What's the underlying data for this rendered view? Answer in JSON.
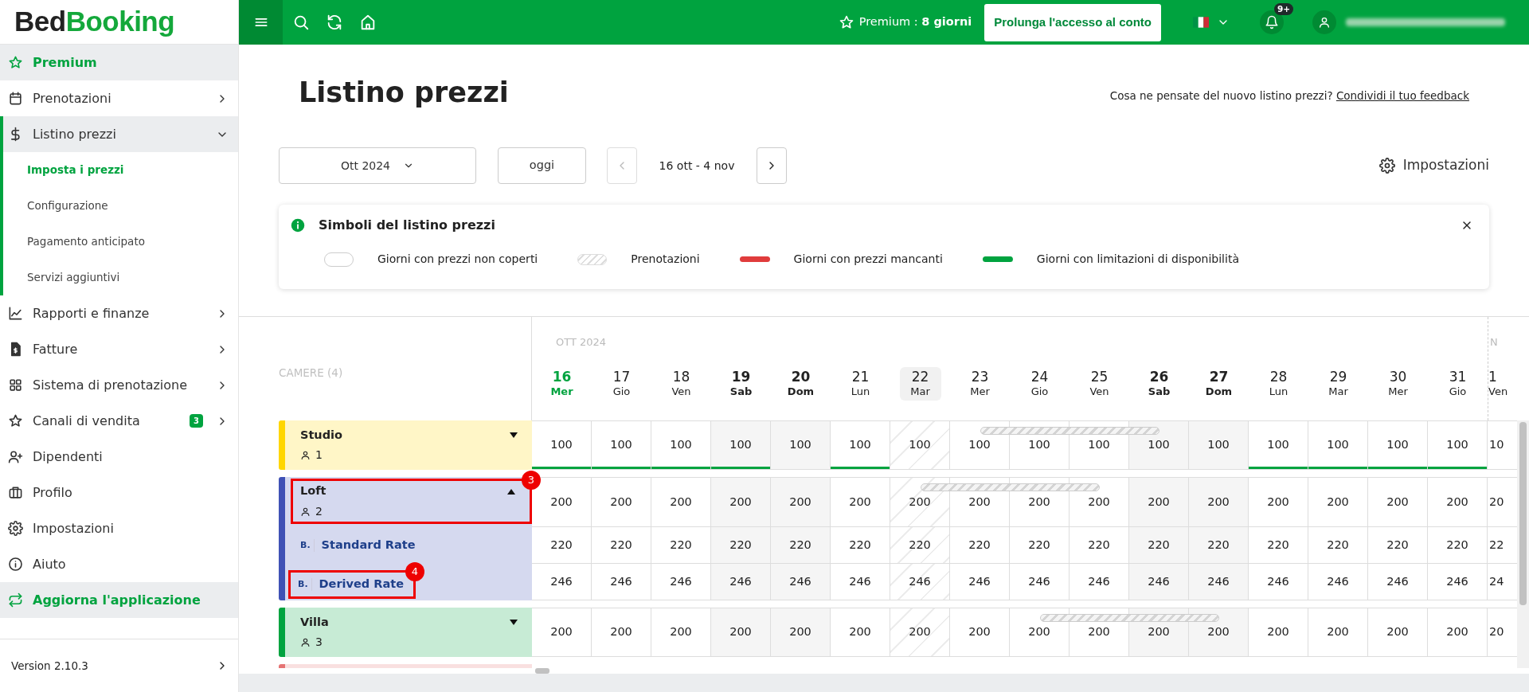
{
  "logo": {
    "dark": "Bed",
    "green": "Booking"
  },
  "topbar": {
    "premium": "Premium : **8 giorni**",
    "extend_button": "Prolunga l'accesso al conto",
    "notifications_badge": "9+"
  },
  "sidebar": {
    "items": [
      {
        "label": "Premium",
        "kind": "highlight"
      },
      {
        "label": "Prenotazioni",
        "kind": "menu",
        "expandable": true,
        "expanded": false
      },
      {
        "label": "Listino prezzi",
        "kind": "menu",
        "expandable": true,
        "expanded": true,
        "children": [
          {
            "label": "Imposta i prezzi",
            "selected": true
          },
          {
            "label": "Configurazione",
            "selected": false
          },
          {
            "label": "Pagamento anticipato",
            "selected": false
          },
          {
            "label": "Servizi aggiuntivi",
            "selected": false
          }
        ]
      },
      {
        "label": "Rapporti e finanze",
        "kind": "menu",
        "expandable": true,
        "expanded": false
      },
      {
        "label": "Fatture",
        "kind": "menu",
        "expandable": true,
        "expanded": false
      },
      {
        "label": "Sistema di prenotazione",
        "kind": "menu",
        "expandable": true,
        "expanded": false
      },
      {
        "label": "Canali di vendita",
        "kind": "menu",
        "expandable": true,
        "expanded": false,
        "badge": "3"
      },
      {
        "label": "Dipendenti",
        "kind": "menu",
        "expandable": false
      },
      {
        "label": "Profilo",
        "kind": "menu",
        "expandable": false
      },
      {
        "label": "Impostazioni",
        "kind": "menu",
        "expandable": false
      },
      {
        "label": "Aiuto",
        "kind": "menu",
        "expandable": false
      },
      {
        "label": "Aggiorna l'applicazione",
        "kind": "highlight"
      }
    ],
    "version": "Version 2.10.3"
  },
  "page": {
    "title": "Listino prezzi",
    "feedback_text": "Cosa ne pensate del nuovo listino prezzi?",
    "feedback_link": "Condividi il tuo feedback"
  },
  "controls": {
    "month": "Ott 2024",
    "today": "oggi",
    "prev_disabled": true,
    "range": "16 ott - 4 nov",
    "settings": "Impostazioni"
  },
  "legend": {
    "title": "Simboli del listino prezzi",
    "items": [
      {
        "kind": "empty",
        "label": "Giorni con prezzi non coperti"
      },
      {
        "kind": "hatched",
        "label": "Prenotazioni"
      },
      {
        "kind": "missing",
        "label": "Giorni con prezzi mancanti"
      },
      {
        "kind": "limited",
        "label": "Giorni con limitazioni di disponibilità"
      }
    ]
  },
  "grid": {
    "rooms_label": "CAMERE (4)",
    "days": [
      {
        "day": "16",
        "weekday": "Mer",
        "kind": "today",
        "month": "OTT 2024"
      },
      {
        "day": "17",
        "weekday": "Gio",
        "kind": "normal"
      },
      {
        "day": "18",
        "weekday": "Ven",
        "kind": "normal"
      },
      {
        "day": "19",
        "weekday": "Sab",
        "kind": "weekend"
      },
      {
        "day": "20",
        "weekday": "Dom",
        "kind": "weekend"
      },
      {
        "day": "21",
        "weekday": "Lun",
        "kind": "normal"
      },
      {
        "day": "22",
        "weekday": "Mar",
        "kind": "marked"
      },
      {
        "day": "23",
        "weekday": "Mer",
        "kind": "normal"
      },
      {
        "day": "24",
        "weekday": "Gio",
        "kind": "normal"
      },
      {
        "day": "25",
        "weekday": "Ven",
        "kind": "normal"
      },
      {
        "day": "26",
        "weekday": "Sab",
        "kind": "weekend"
      },
      {
        "day": "27",
        "weekday": "Dom",
        "kind": "weekend"
      },
      {
        "day": "28",
        "weekday": "Lun",
        "kind": "normal"
      },
      {
        "day": "29",
        "weekday": "Mar",
        "kind": "normal"
      },
      {
        "day": "30",
        "weekday": "Mer",
        "kind": "normal"
      },
      {
        "day": "31",
        "weekday": "Gio",
        "kind": "normal"
      },
      {
        "day": "1",
        "weekday": "Ven",
        "kind": "cut",
        "month": "N"
      }
    ],
    "rooms": [
      {
        "kind": "room",
        "name": "Studio",
        "guests": "1",
        "color": "#ffd600",
        "expanded": false,
        "cells": [
          {
            "value": "100",
            "booked": false,
            "limited": true
          },
          {
            "value": "100",
            "booked": false,
            "limited": true
          },
          {
            "value": "100",
            "booked": false,
            "limited": true
          },
          {
            "value": "100",
            "booked": false,
            "limited": true
          },
          {
            "value": "100",
            "booked": false,
            "limited": false
          },
          {
            "value": "100",
            "booked": false,
            "limited": true
          },
          {
            "value": "100",
            "booked": false,
            "limited": false
          },
          {
            "value": "100",
            "booked": true,
            "limited": false
          },
          {
            "value": "100",
            "booked": true,
            "limited": false
          },
          {
            "value": "100",
            "booked": true,
            "limited": false
          },
          {
            "value": "100",
            "booked": true,
            "limited": false
          },
          {
            "value": "100",
            "booked": false,
            "limited": false
          },
          {
            "value": "100",
            "booked": false,
            "limited": true
          },
          {
            "value": "100",
            "booked": false,
            "limited": true
          },
          {
            "value": "100",
            "booked": false,
            "limited": true
          },
          {
            "value": "100",
            "booked": false,
            "limited": true
          },
          {
            "value": "10",
            "booked": false,
            "limited": false
          }
        ]
      },
      {
        "kind": "room",
        "name": "Loft",
        "guests": "2",
        "color": "#3f51b5",
        "expanded": true,
        "callout": "3",
        "cells": [
          {
            "value": "200",
            "booked": false,
            "limited": false
          },
          {
            "value": "200",
            "booked": false,
            "limited": false
          },
          {
            "value": "200",
            "booked": false,
            "limited": false
          },
          {
            "value": "200",
            "booked": false,
            "limited": false
          },
          {
            "value": "200",
            "booked": false,
            "limited": false
          },
          {
            "value": "200",
            "booked": false,
            "limited": false
          },
          {
            "value": "200",
            "booked": true,
            "limited": false
          },
          {
            "value": "200",
            "booked": true,
            "limited": false
          },
          {
            "value": "200",
            "booked": true,
            "limited": false
          },
          {
            "value": "200",
            "booked": true,
            "limited": false
          },
          {
            "value": "200",
            "booked": false,
            "limited": false
          },
          {
            "value": "200",
            "booked": false,
            "limited": false
          },
          {
            "value": "200",
            "booked": false,
            "limited": false
          },
          {
            "value": "200",
            "booked": false,
            "limited": false
          },
          {
            "value": "200",
            "booked": false,
            "limited": false
          },
          {
            "value": "200",
            "booked": false,
            "limited": false
          },
          {
            "value": "20",
            "booked": false,
            "limited": false
          }
        ],
        "rates": [
          {
            "mark": "B.",
            "name": "Standard Rate",
            "cells": [
              "220",
              "220",
              "220",
              "220",
              "220",
              "220",
              "220",
              "220",
              "220",
              "220",
              "220",
              "220",
              "220",
              "220",
              "220",
              "220",
              "22"
            ]
          },
          {
            "mark": "B.",
            "name": "Derived Rate",
            "callout": "4",
            "cells": [
              "246",
              "246",
              "246",
              "246",
              "246",
              "246",
              "246",
              "246",
              "246",
              "246",
              "246",
              "246",
              "246",
              "246",
              "246",
              "246",
              "24"
            ]
          }
        ]
      },
      {
        "kind": "room",
        "name": "Villa",
        "guests": "3",
        "color": "#00a33f",
        "expanded": false,
        "cells": [
          {
            "value": "200",
            "booked": false,
            "limited": false
          },
          {
            "value": "200",
            "booked": false,
            "limited": false
          },
          {
            "value": "200",
            "booked": false,
            "limited": false
          },
          {
            "value": "200",
            "booked": false,
            "limited": false
          },
          {
            "value": "200",
            "booked": false,
            "limited": false
          },
          {
            "value": "200",
            "booked": false,
            "limited": false
          },
          {
            "value": "200",
            "booked": false,
            "limited": false
          },
          {
            "value": "200",
            "booked": false,
            "limited": false
          },
          {
            "value": "200",
            "booked": true,
            "limited": false
          },
          {
            "value": "200",
            "booked": true,
            "limited": false
          },
          {
            "value": "200",
            "booked": true,
            "limited": false
          },
          {
            "value": "200",
            "booked": true,
            "limited": false
          },
          {
            "value": "200",
            "booked": false,
            "limited": false
          },
          {
            "value": "200",
            "booked": false,
            "limited": false
          },
          {
            "value": "200",
            "booked": false,
            "limited": false
          },
          {
            "value": "200",
            "booked": false,
            "limited": false
          },
          {
            "value": "20",
            "booked": false,
            "limited": false
          }
        ]
      },
      {
        "kind": "cut",
        "color": "#e57373"
      }
    ]
  }
}
